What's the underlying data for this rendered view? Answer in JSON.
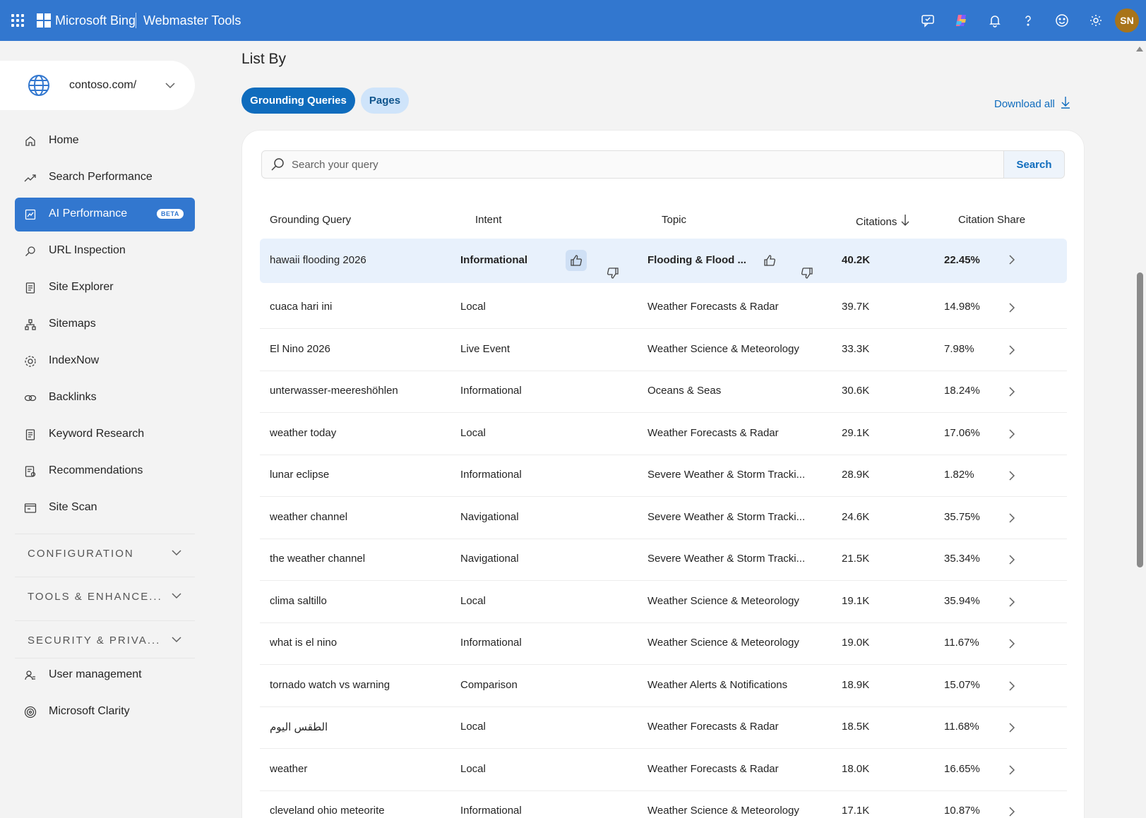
{
  "header": {
    "brand": "Microsoft Bing",
    "product": "Webmaster Tools",
    "avatar_initials": "SN",
    "bar_color": "#3277cf",
    "icons": [
      "feedback-icon",
      "copilot-icon",
      "bell-icon",
      "help-icon",
      "smiley-icon",
      "gear-icon"
    ]
  },
  "site": {
    "name": "contoso.com/"
  },
  "sidebar": {
    "items": [
      {
        "label": "Home",
        "icon": "home-icon"
      },
      {
        "label": "Search Performance",
        "icon": "trend-icon"
      },
      {
        "label": "AI Performance",
        "icon": "ai-chart-icon",
        "badge": "BETA",
        "active": true
      },
      {
        "label": "URL Inspection",
        "icon": "search-icon"
      },
      {
        "label": "Site Explorer",
        "icon": "document-icon"
      },
      {
        "label": "Sitemaps",
        "icon": "sitemap-icon"
      },
      {
        "label": "IndexNow",
        "icon": "gear-icon"
      },
      {
        "label": "Backlinks",
        "icon": "link-icon"
      },
      {
        "label": "Keyword Research",
        "icon": "document-icon"
      },
      {
        "label": "Recommendations",
        "icon": "checklist-icon"
      },
      {
        "label": "Site Scan",
        "icon": "scan-icon"
      }
    ],
    "sections": [
      {
        "label": "CONFIGURATION"
      },
      {
        "label": "TOOLS & ENHANCE..."
      },
      {
        "label": "SECURITY & PRIVA..."
      }
    ],
    "bottom_items": [
      {
        "label": "User management",
        "icon": "user-icon"
      },
      {
        "label": "Microsoft Clarity",
        "icon": "clarity-icon"
      }
    ]
  },
  "main": {
    "list_by": "List By",
    "tabs": [
      {
        "label": "Grounding Queries",
        "active": true
      },
      {
        "label": "Pages",
        "active": false
      }
    ],
    "download_all": "Download all",
    "search": {
      "placeholder": "Search your query",
      "button": "Search"
    },
    "table": {
      "headers": [
        "Grounding Query",
        "Intent",
        "Topic",
        "Citations",
        "Citation Share"
      ],
      "rows": [
        {
          "query": "hawaii flooding 2026",
          "intent": "Informational",
          "topic": "Flooding & Flood ...",
          "citations": "40.2K",
          "share": "22.45%"
        },
        {
          "query": "cuaca hari ini",
          "intent": "Local",
          "topic": "Weather Forecasts & Radar",
          "citations": "39.7K",
          "share": "14.98%"
        },
        {
          "query": "El Nino 2026",
          "intent": "Live Event",
          "topic": "Weather Science & Meteorology",
          "citations": "33.3K",
          "share": "7.98%"
        },
        {
          "query": "unterwasser-meereshöhlen",
          "intent": "Informational",
          "topic": "Oceans & Seas",
          "citations": "30.6K",
          "share": "18.24%"
        },
        {
          "query": "weather today",
          "intent": "Local",
          "topic": "Weather Forecasts & Radar",
          "citations": "29.1K",
          "share": "17.06%"
        },
        {
          "query": "lunar eclipse",
          "intent": "Informational",
          "topic": "Severe Weather & Storm Tracki...",
          "citations": "28.9K",
          "share": "1.82%"
        },
        {
          "query": "weather channel",
          "intent": "Navigational",
          "topic": "Severe Weather & Storm Tracki...",
          "citations": "24.6K",
          "share": "35.75%"
        },
        {
          "query": "the weather channel",
          "intent": "Navigational",
          "topic": "Severe Weather & Storm Tracki...",
          "citations": "21.5K",
          "share": "35.34%"
        },
        {
          "query": "clima saltillo",
          "intent": "Local",
          "topic": "Weather Science & Meteorology",
          "citations": "19.1K",
          "share": "35.94%"
        },
        {
          "query": "what is el nino",
          "intent": "Informational",
          "topic": "Weather Science & Meteorology",
          "citations": "19.0K",
          "share": "11.67%"
        },
        {
          "query": "tornado watch vs warning",
          "intent": "Comparison",
          "topic": "Weather Alerts & Notifications",
          "citations": "18.9K",
          "share": "15.07%"
        },
        {
          "query": "الطقس اليوم",
          "intent": "Local",
          "topic": "Weather Forecasts & Radar",
          "citations": "18.5K",
          "share": "11.68%"
        },
        {
          "query": "weather",
          "intent": "Local",
          "topic": "Weather Forecasts & Radar",
          "citations": "18.0K",
          "share": "16.65%"
        },
        {
          "query": "cleveland ohio meteorite",
          "intent": "Informational",
          "topic": "Weather Science & Meteorology",
          "citations": "17.1K",
          "share": "10.87%"
        }
      ]
    }
  }
}
